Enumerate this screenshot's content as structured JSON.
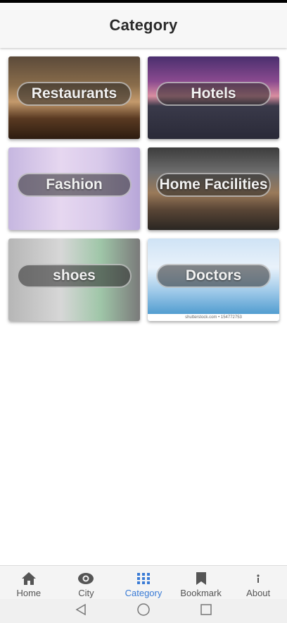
{
  "app_bar": {
    "title": "Category"
  },
  "categories": [
    {
      "label": "Restaurants"
    },
    {
      "label": "Hotels"
    },
    {
      "label": "Fashion"
    },
    {
      "label": "Home Facilities"
    },
    {
      "label": "shoes"
    },
    {
      "label": "Doctors",
      "credit": "shutterstock.com • 154772753"
    }
  ],
  "bottom_nav": {
    "items": [
      {
        "label": "Home",
        "icon": "home-icon"
      },
      {
        "label": "City",
        "icon": "eye-icon"
      },
      {
        "label": "Category",
        "icon": "grid-icon",
        "active": true
      },
      {
        "label": "Bookmark",
        "icon": "bookmark-icon"
      },
      {
        "label": "About",
        "icon": "info-icon"
      }
    ],
    "active_color": "#3a7bd5",
    "inactive_color": "#555555"
  },
  "system_nav": {
    "buttons": [
      "back",
      "home",
      "recents"
    ]
  }
}
